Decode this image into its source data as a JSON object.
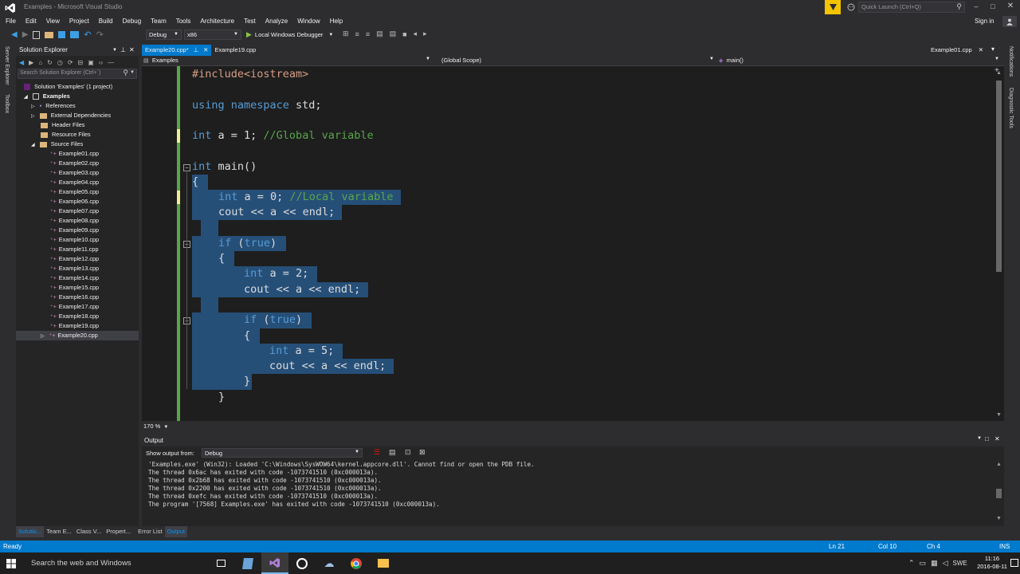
{
  "window": {
    "title": "Examples - Microsoft Visual Studio"
  },
  "quick_launch": {
    "placeholder": "Quick Launch (Ctrl+Q)"
  },
  "sign_in": "Sign in",
  "menu": [
    "File",
    "Edit",
    "View",
    "Project",
    "Build",
    "Debug",
    "Team",
    "Tools",
    "Architecture",
    "Test",
    "Analyze",
    "Window",
    "Help"
  ],
  "toolbar": {
    "config": "Debug",
    "platform": "x86",
    "run_label": "Local Windows Debugger"
  },
  "side_left": {
    "server_explorer": "Server Explorer",
    "toolbox": "Toolbox"
  },
  "side_right": {
    "notifications": "Notifications",
    "diagnostic": "Diagnostic Tools"
  },
  "solution_explorer": {
    "title": "Solution Explorer",
    "search_placeholder": "Search Solution Explorer (Ctrl+´)",
    "root": "Solution 'Examples' (1 project)",
    "project": "Examples",
    "folders": [
      "References",
      "External Dependencies",
      "Header Files",
      "Resource Files",
      "Source Files"
    ],
    "files": [
      "Example01.cpp",
      "Example02.cpp",
      "Example03.cpp",
      "Example04.cpp",
      "Example05.cpp",
      "Example06.cpp",
      "Example07.cpp",
      "Example08.cpp",
      "Example09.cpp",
      "Example10.cpp",
      "Example11.cpp",
      "Example12.cpp",
      "Example13.cpp",
      "Example14.cpp",
      "Example15.cpp",
      "Example16.cpp",
      "Example17.cpp",
      "Example18.cpp",
      "Example19.cpp",
      "Example20.cpp"
    ]
  },
  "editor": {
    "tabs": [
      "Example20.cpp*",
      "Example19.cpp"
    ],
    "preview_tab": "Example01.cpp",
    "nav_project": "Examples",
    "nav_scope": "(Global Scope)",
    "nav_member": "main()",
    "zoom": "170 %",
    "code": {
      "l1": "#include<iostream>",
      "l2_kw": "using namespace",
      "l2_rest": " std;",
      "l3_kw": "int",
      "l3_rest": " a = 1; ",
      "l3_cm": "//Global variable",
      "l4_kw": "int",
      "l4_rest": " main()",
      "l5": "{",
      "l6_kw": "int",
      "l6_rest": " a = 0; ",
      "l6_cm": "//Local variable",
      "l7": "cout << a << endl;",
      "l8_kw": "if",
      "l8_rest": " (",
      "l8_kw2": "true",
      "l8_end": ")",
      "l9": "{",
      "l10_kw": "int",
      "l10_rest": " a = 2;",
      "l11": "cout << a << endl;",
      "l12_kw": "if",
      "l12_rest": " (",
      "l12_kw2": "true",
      "l12_end": ")",
      "l13": "{",
      "l14_kw": "int",
      "l14_rest": " a = 5;",
      "l15": "cout << a << endl;",
      "l16": "}",
      "l17": "}"
    }
  },
  "output": {
    "title": "Output",
    "show_from_label": "Show output from:",
    "source": "Debug",
    "lines": [
      "'Examples.exe' (Win32): Loaded 'C:\\Windows\\SysWOW64\\kernel.appcore.dll'. Cannot find or open the PDB file.",
      "The thread 0x6ac has exited with code -1073741510 (0xc000013a).",
      "The thread 0x2b68 has exited with code -1073741510 (0xc000013a).",
      "The thread 0x2200 has exited with code -1073741510 (0xc000013a).",
      "The thread 0xefc has exited with code -1073741510 (0xc000013a).",
      "The program '[7568] Examples.exe' has exited with code -1073741510 (0xc000013a)."
    ]
  },
  "bottom_tabs_left": [
    "Solutio...",
    "Team E...",
    "Class V...",
    "Propert..."
  ],
  "bottom_tabs_right": [
    "Error List",
    "Output"
  ],
  "status": {
    "text": "Ready",
    "ln": "Ln 21",
    "col": "Col 10",
    "ch": "Ch 4",
    "mode": "INS"
  },
  "taskbar": {
    "search": "Search the web and Windows",
    "lang": "SWE",
    "time": "11:16",
    "date": "2016-08-11"
  },
  "colors": {
    "accent": "#007acc",
    "selection": "#264f78",
    "keyword": "#569cd6",
    "comment": "#57a64a",
    "string": "#d69d85",
    "vs_purple": "#68217a"
  }
}
